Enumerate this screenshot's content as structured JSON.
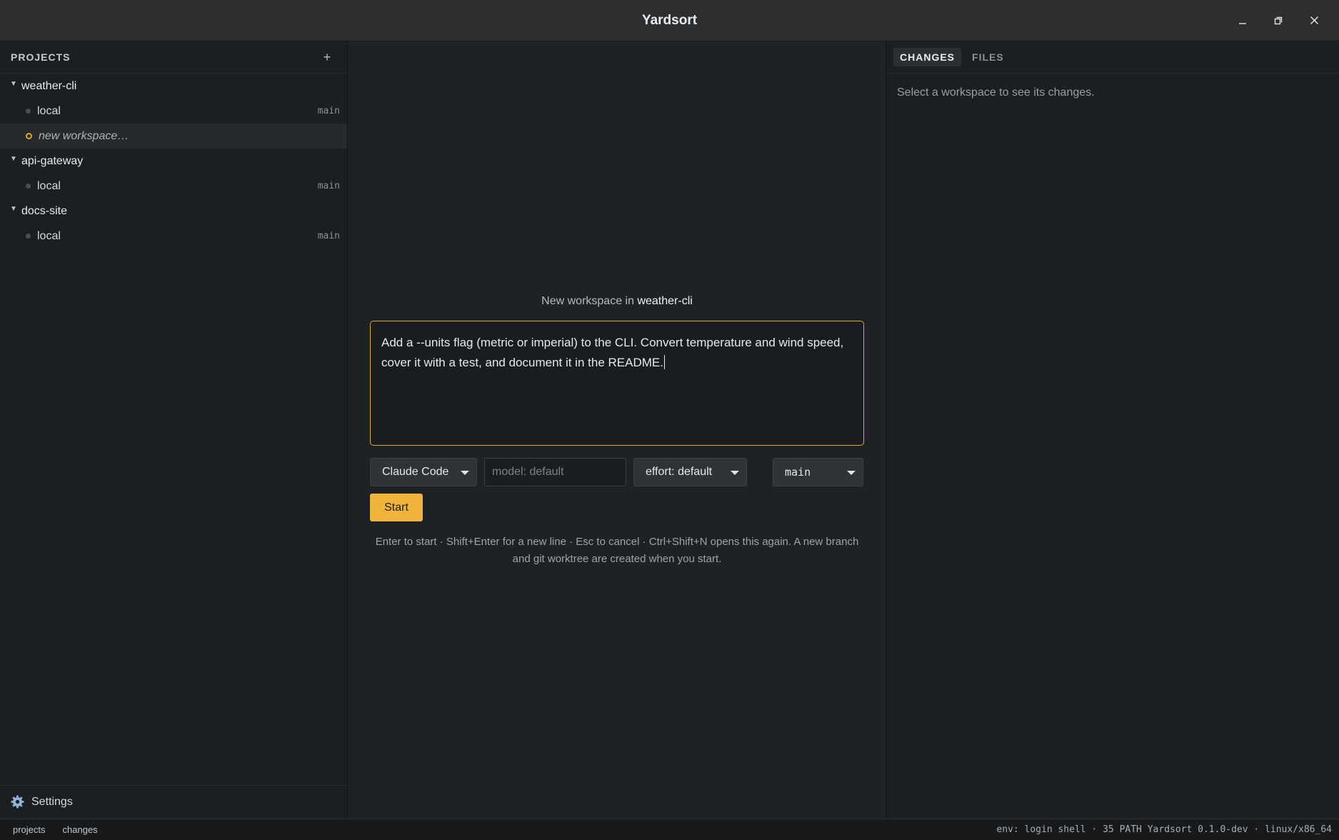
{
  "window": {
    "title": "Yardsort",
    "controls": [
      "minimize-icon",
      "restore-icon",
      "close-icon"
    ]
  },
  "sidebar": {
    "header": "PROJECTS",
    "add_label": "+",
    "projects": [
      {
        "name": "weather-cli",
        "workspaces": [
          {
            "name": "local",
            "branch": "main"
          }
        ],
        "pending": "new workspace…"
      },
      {
        "name": "api-gateway",
        "workspaces": [
          {
            "name": "local",
            "branch": "main"
          }
        ]
      },
      {
        "name": "docs-site",
        "workspaces": [
          {
            "name": "local",
            "branch": "main"
          }
        ]
      }
    ],
    "settings_label": "Settings"
  },
  "right_panel": {
    "tabs": [
      {
        "label": "CHANGES",
        "active": true
      },
      {
        "label": "FILES",
        "active": false
      }
    ],
    "empty_message": "Select a workspace to see its changes."
  },
  "modal": {
    "title_prefix": "New workspace in",
    "project": "weather-cli",
    "prompt_text": "Add a --units flag (metric or imperial) to the CLI. Convert temperature and wind speed, cover it with a test, and document it in the README.",
    "agent": "Claude Code",
    "model_placeholder": "model: default",
    "effort": "effort: default",
    "branch": "main",
    "start_label": "Start",
    "hint": "Enter to start · Shift+Enter for a new line · Esc to cancel · Ctrl+Shift+N opens this again. A new branch and git worktree are created when you start."
  },
  "statusbar": {
    "left_items": [
      "projects",
      "changes"
    ],
    "right_info": "env: login shell · 35 PATH  Yardsort 0.1.0-dev · linux/x86_64"
  },
  "colors": {
    "accent": "#f0b43a",
    "background": "#202325"
  }
}
